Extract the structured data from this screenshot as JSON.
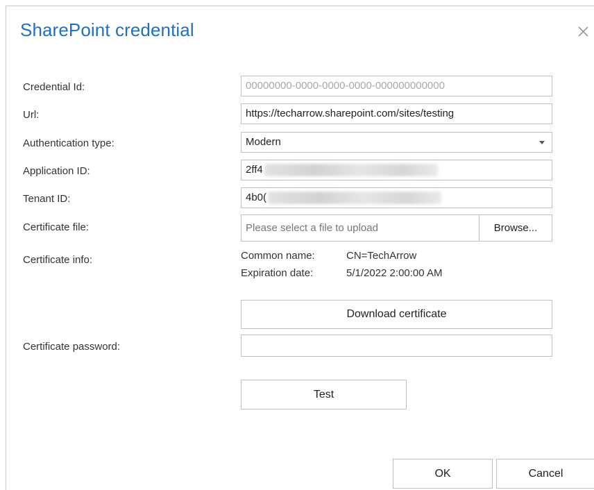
{
  "dialog": {
    "title": "SharePoint credential",
    "close_icon": "close-icon"
  },
  "form": {
    "credential_id": {
      "label": "Credential Id:",
      "value": "00000000-0000-0000-0000-000000000000"
    },
    "url": {
      "label": "Url:",
      "value": "https://techarrow.sharepoint.com/sites/testing"
    },
    "authentication_type": {
      "label": "Authentication type:",
      "value": "Modern",
      "dropdown_icon": "chevron-down-icon"
    },
    "application_id": {
      "label": "Application ID:",
      "value": "2ff4"
    },
    "tenant_id": {
      "label": "Tenant ID:",
      "value": "4b0("
    },
    "certificate_file": {
      "label": "Certificate file:",
      "placeholder": "Please select a file to upload",
      "browse_label": "Browse..."
    },
    "certificate_info": {
      "label": "Certificate info:",
      "common_name_label": "Common name:",
      "common_name_value": "CN=TechArrow",
      "expiration_label": "Expiration date:",
      "expiration_value": "5/1/2022 2:00:00 AM"
    },
    "download_certificate_label": "Download certificate",
    "certificate_password": {
      "label": "Certificate password:",
      "value": ""
    },
    "test_label": "Test"
  },
  "footer": {
    "ok_label": "OK",
    "cancel_label": "Cancel"
  }
}
